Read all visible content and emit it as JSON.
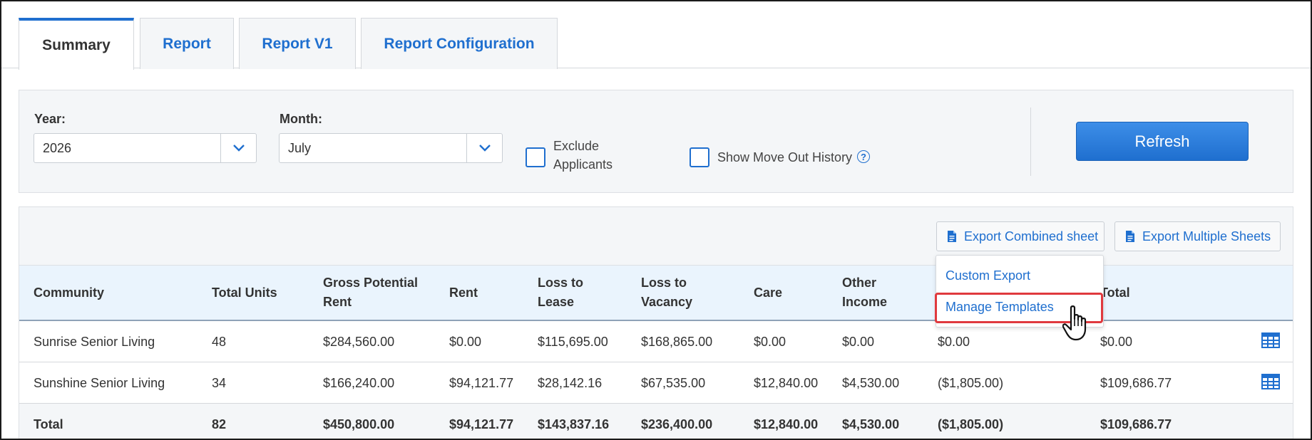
{
  "tabs": [
    {
      "label": "Summary",
      "active": true
    },
    {
      "label": "Report",
      "active": false
    },
    {
      "label": "Report V1",
      "active": false
    },
    {
      "label": "Report Configuration",
      "active": false
    }
  ],
  "filters": {
    "year_label": "Year:",
    "year_value": "2026",
    "month_label": "Month:",
    "month_value": "July",
    "exclude_applicants_line1": "Exclude",
    "exclude_applicants_line2": "Applicants",
    "exclude_applicants_checked": false,
    "show_move_out_label": "Show Move Out History",
    "show_move_out_checked": false,
    "help_glyph": "?",
    "refresh_label": "Refresh"
  },
  "toolbar": {
    "export_combined_label": "Export Combined sheet",
    "export_multiple_label": "Export Multiple Sheets"
  },
  "dropdown": {
    "items": [
      "Custom Export",
      "Manage Templates"
    ],
    "highlighted": "Manage Templates"
  },
  "table": {
    "headers": [
      [
        "Community"
      ],
      [
        "Total Units"
      ],
      [
        "Gross Potential",
        "Rent"
      ],
      [
        "Rent"
      ],
      [
        "Loss to",
        "Lease"
      ],
      [
        "Loss to",
        "Vacancy"
      ],
      [
        "Care"
      ],
      [
        "Other",
        "Income"
      ],
      [
        ""
      ],
      [
        "Total"
      ]
    ],
    "rows": [
      [
        "Sunrise Senior Living",
        "48",
        "$284,560.00",
        "$0.00",
        "$115,695.00",
        "$168,865.00",
        "$0.00",
        "$0.00",
        "$0.00",
        "$0.00"
      ],
      [
        "Sunshine Senior Living",
        "34",
        "$166,240.00",
        "$94,121.77",
        "$28,142.16",
        "$67,535.00",
        "$12,840.00",
        "$4,530.00",
        "($1,805.00)",
        "$109,686.77"
      ]
    ],
    "total_row": [
      "Total",
      "82",
      "$450,800.00",
      "$94,121.77",
      "$143,837.16",
      "$236,400.00",
      "$12,840.00",
      "$4,530.00",
      "($1,805.00)",
      "$109,686.77"
    ]
  },
  "colors": {
    "accent": "#1f6fcf",
    "highlight_border": "#e0393e",
    "header_bg": "#eaf4fd"
  },
  "icons": [
    "chevron-down-icon",
    "help-icon",
    "document-icon",
    "table-grid-icon",
    "hand-pointer-icon"
  ]
}
